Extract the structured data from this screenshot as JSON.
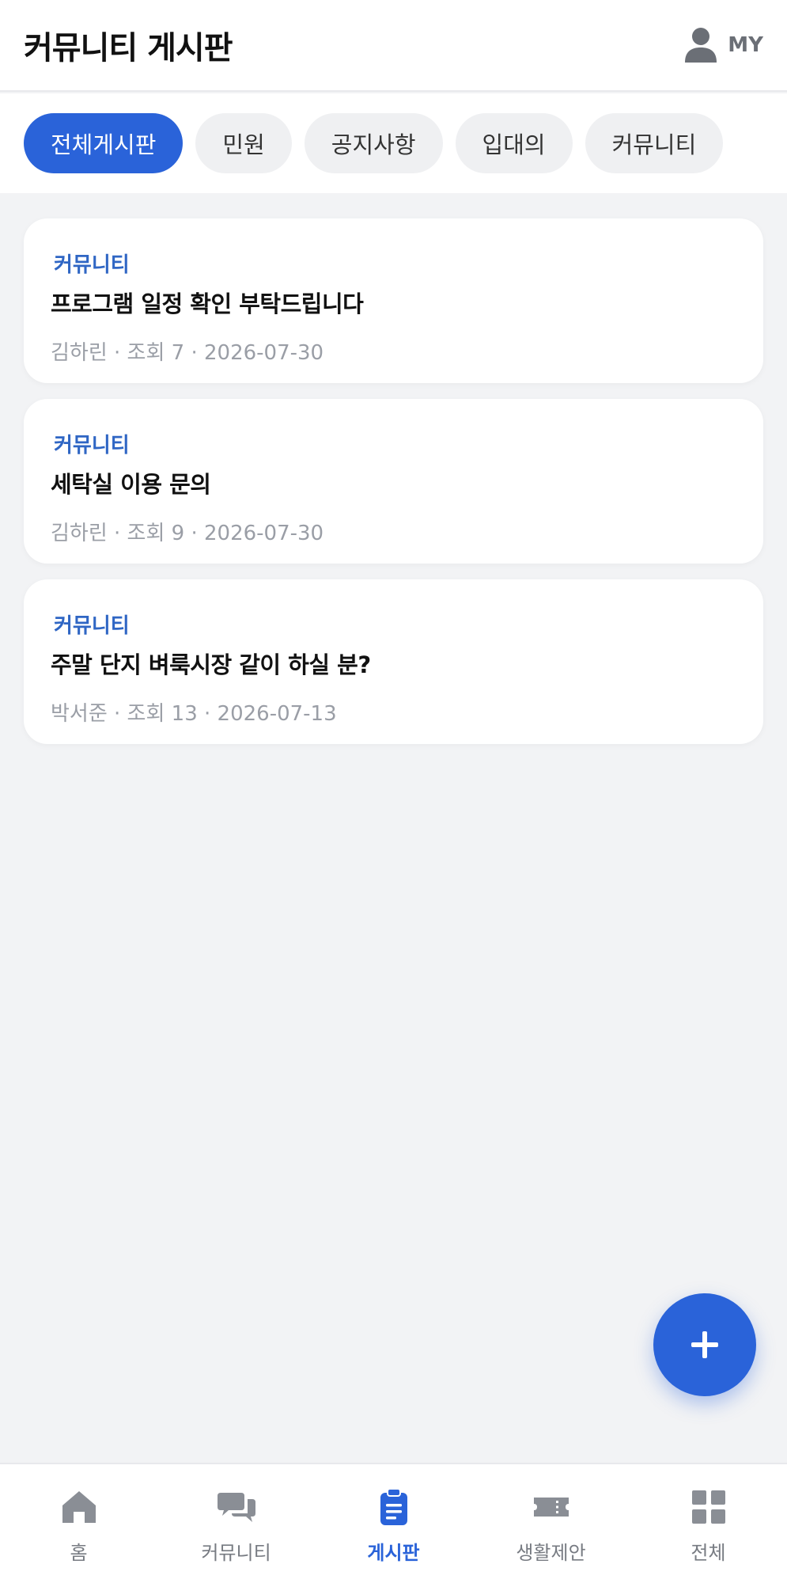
{
  "header": {
    "title": "커뮤니티 게시판",
    "my_label": "MY",
    "my_icon": "user-icon"
  },
  "tabs": [
    {
      "label": "전체게시판",
      "active": true
    },
    {
      "label": "민원",
      "active": false
    },
    {
      "label": "공지사항",
      "active": false
    },
    {
      "label": "입대의",
      "active": false
    },
    {
      "label": "커뮤니티",
      "active": false
    }
  ],
  "posts": [
    {
      "category": "커뮤니티",
      "title": "프로그램 일정 확인 부탁드립니다",
      "meta": "김하린 · 조회 7 · 2026-07-30"
    },
    {
      "category": "커뮤니티",
      "title": "세탁실 이용 문의",
      "meta": "김하린 · 조회 9 · 2026-07-30"
    },
    {
      "category": "커뮤니티",
      "title": "주말 단지 벼룩시장 같이 하실 분?",
      "meta": "박서준 · 조회 13 · 2026-07-13"
    }
  ],
  "fab": {
    "icon": "plus-icon"
  },
  "bottom_nav": [
    {
      "label": "홈",
      "icon": "home-icon",
      "active": false
    },
    {
      "label": "커뮤니티",
      "icon": "chat-icon",
      "active": false
    },
    {
      "label": "게시판",
      "icon": "clipboard-icon",
      "active": true
    },
    {
      "label": "생활제안",
      "icon": "ticket-icon",
      "active": false
    },
    {
      "label": "전체",
      "icon": "grid-icon",
      "active": false
    }
  ],
  "colors": {
    "accent": "#2a63d9",
    "category": "#2f66c4",
    "background": "#f2f3f5",
    "inactive_nav": "#777b82"
  }
}
